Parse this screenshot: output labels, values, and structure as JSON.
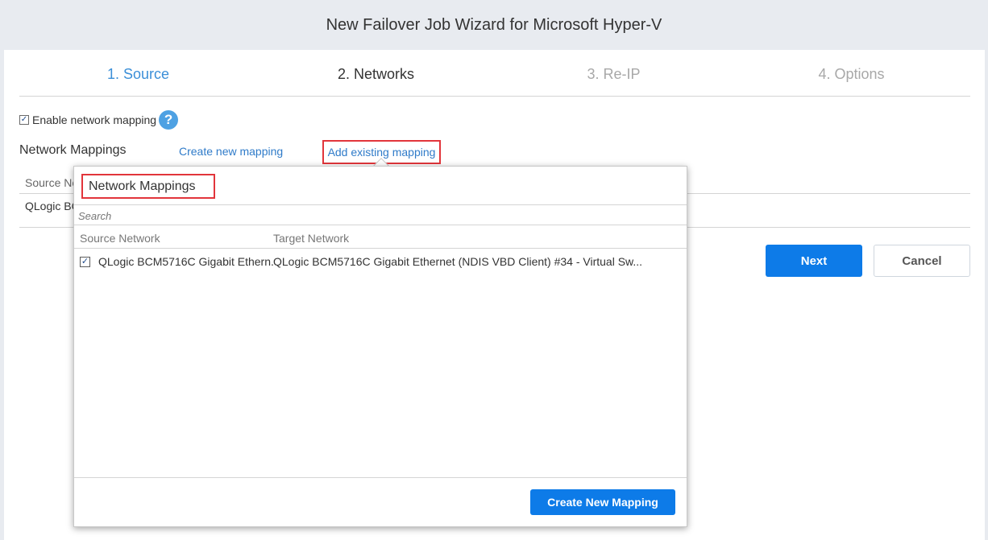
{
  "window": {
    "title": "New Failover Job Wizard for Microsoft Hyper-V"
  },
  "steps": [
    {
      "label": "1. Source"
    },
    {
      "label": "2. Networks"
    },
    {
      "label": "3. Re-IP"
    },
    {
      "label": "4. Options"
    }
  ],
  "enable_mapping": {
    "label": "Enable network mapping",
    "checked": true,
    "help_glyph": "?"
  },
  "mappings": {
    "title": "Network Mappings",
    "create_link": "Create new mapping",
    "add_link": "Add existing mapping",
    "table_header_source": "Source Ne",
    "table_row_source": "QLogic BC"
  },
  "buttons": {
    "next": "Next",
    "cancel": "Cancel"
  },
  "popup": {
    "title": "Network Mappings",
    "search_placeholder": "Search",
    "columns": {
      "source": "Source Network",
      "target": "Target Network"
    },
    "rows": [
      {
        "checked": true,
        "source": "QLogic BCM5716C Gigabit Ethern...",
        "target": "QLogic BCM5716C Gigabit Ethernet (NDIS VBD Client) #34 - Virtual Sw..."
      }
    ],
    "create_button": "Create New Mapping"
  },
  "colors": {
    "accent": "#0d7be8",
    "link": "#2f7bc9",
    "highlight": "#e2353b",
    "step_active": "#3b8fd8"
  },
  "icons": {
    "help": "question-circle-icon",
    "checkbox": "checkbox-checked-icon"
  }
}
